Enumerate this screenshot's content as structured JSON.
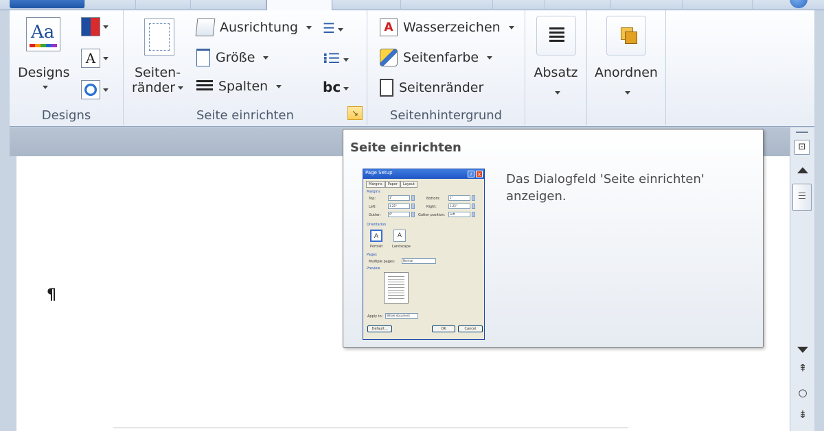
{
  "ribbon": {
    "groups": {
      "designs": {
        "label": "Designs",
        "designs_button": "Designs"
      },
      "page_setup": {
        "label": "Seite einrichten",
        "margins_button_line1": "Seiten-",
        "margins_button_line2": "ränder",
        "orientation": "Ausrichtung",
        "size": "Größe",
        "columns": "Spalten"
      },
      "page_background": {
        "label": "Seitenhintergrund",
        "watermark": "Wasserzeichen",
        "page_color": "Seitenfarbe",
        "page_borders": "Seitenränder"
      },
      "paragraph": {
        "label": "Absatz"
      },
      "arrange": {
        "label": "Anordnen"
      }
    }
  },
  "document": {
    "pilcrow": "¶"
  },
  "tooltip": {
    "title": "Seite einrichten",
    "description": "Das Dialogfeld 'Seite einrichten' anzeigen.",
    "preview": {
      "title": "Page Setup",
      "help": "?",
      "close": "X",
      "tabs": [
        "Margins",
        "Paper",
        "Layout"
      ],
      "section_margins": "Margins",
      "fields": [
        {
          "label": "Top:",
          "value": "1\""
        },
        {
          "label": "Bottom:",
          "value": "1\""
        },
        {
          "label": "Left:",
          "value": "1.25\""
        },
        {
          "label": "Right:",
          "value": "1.25\""
        },
        {
          "label": "Gutter:",
          "value": "0\""
        },
        {
          "label": "Gutter position:",
          "value": "Left"
        }
      ],
      "section_orientation": "Orientation",
      "portrait": "Portrait",
      "landscape": "Landscape",
      "section_pages": "Pages",
      "multiple_pages_label": "Multiple pages:",
      "multiple_pages_value": "Normal",
      "section_preview": "Preview",
      "apply_to_label": "Apply to:",
      "apply_to_value": "Whole document",
      "default_button": "Default...",
      "ok_button": "OK",
      "cancel_button": "Cancel"
    }
  },
  "colors": {
    "ribbon_bg": "#fdfeff",
    "frame": "#c9d4e2",
    "accent_blue": "#1f56a8",
    "launcher": "#ffcd58"
  },
  "icons": {
    "designs": "themes-icon",
    "colors": "theme-colors-icon",
    "fonts": "theme-fonts-icon",
    "effects": "theme-effects-icon",
    "margins": "margins-icon",
    "orientation": "orientation-icon",
    "size": "size-icon",
    "columns": "columns-icon",
    "breaks": "breaks-icon",
    "line_numbers": "line-numbers-icon",
    "hyphenation": "hyphenation-icon",
    "watermark": "watermark-icon",
    "page_color": "page-color-icon",
    "page_borders": "page-borders-icon",
    "paragraph": "paragraph-icon",
    "arrange": "arrange-icon",
    "launcher": "dialog-launcher-icon"
  }
}
